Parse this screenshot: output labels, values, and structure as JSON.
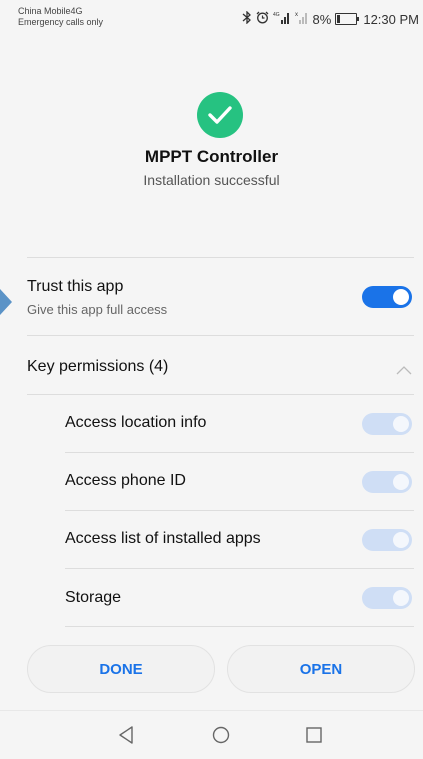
{
  "status_bar": {
    "carrier": "China Mobile4G",
    "emergency": "Emergency calls only",
    "battery": "8%",
    "time": "12:30 PM",
    "icons": [
      "bluetooth-icon",
      "alarm-icon",
      "signal-icon",
      "signal-icon",
      "battery-icon"
    ]
  },
  "install": {
    "app_name": "MPPT Controller",
    "status": "Installation successful",
    "icon": "check-circle-icon",
    "accent_color": "#26c281"
  },
  "trust": {
    "title": "Trust this app",
    "subtitle": "Give this app full access",
    "enabled": true
  },
  "permissions": {
    "header": "Key permissions (4)",
    "items": [
      {
        "label": "Access location info",
        "enabled": true
      },
      {
        "label": "Access phone ID",
        "enabled": true
      },
      {
        "label": "Access list of installed apps",
        "enabled": true
      },
      {
        "label": "Storage",
        "enabled": true
      }
    ]
  },
  "actions": {
    "done_label": "DONE",
    "open_label": "OPEN"
  },
  "theme": {
    "primary": "#1a73e8",
    "toggle_disabled": "#cfdef5"
  },
  "nav": {
    "icons": [
      "back-icon",
      "home-icon",
      "recents-icon"
    ]
  }
}
